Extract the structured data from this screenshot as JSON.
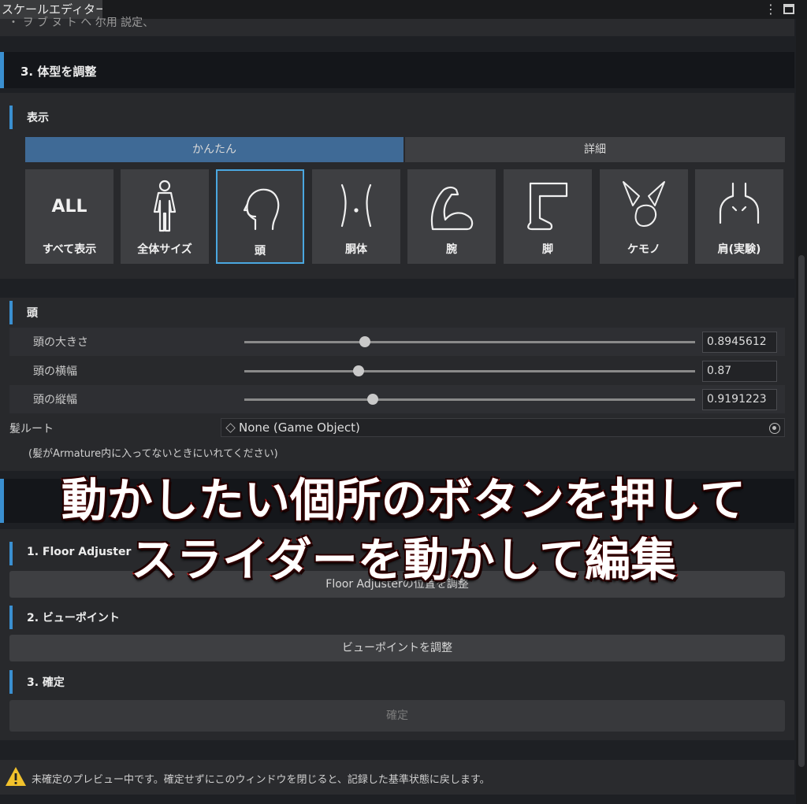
{
  "window": {
    "tab_title": "スケールエディター",
    "kebab": "⋮"
  },
  "top_cut_text": "・ ヲ ブ ヌ ト ヘ 尔用 説定、",
  "section3": {
    "title": "3. 体型を調整",
    "display_label": "表示",
    "tabs": [
      {
        "label": "かんたん",
        "active": true
      },
      {
        "label": "詳細",
        "active": false
      }
    ],
    "parts": [
      {
        "label": "すべて表示",
        "icon": "all-text-icon",
        "icon_text": "ALL"
      },
      {
        "label": "全体サイズ",
        "icon": "person-icon"
      },
      {
        "label": "頭",
        "icon": "head-icon",
        "selected": true
      },
      {
        "label": "胴体",
        "icon": "torso-icon"
      },
      {
        "label": "腕",
        "icon": "arm-icon"
      },
      {
        "label": "脚",
        "icon": "leg-icon"
      },
      {
        "label": "ケモノ",
        "icon": "kemono-ears-icon"
      },
      {
        "label": "肩(実験)",
        "icon": "shoulder-icon"
      }
    ]
  },
  "head": {
    "title": "頭",
    "sliders": [
      {
        "label": "頭の大きさ",
        "value": "0.8945612",
        "position": 0.28
      },
      {
        "label": "頭の横幅",
        "value": "0.87",
        "position": 0.255
      },
      {
        "label": "頭の縦幅",
        "value": "0.9191223",
        "position": 0.29
      }
    ],
    "hair_root": {
      "label": "髪ルート",
      "value": "None (Game Object)",
      "hint": "(髪がArmature内に入ってないときにいれてください)"
    }
  },
  "section4": {
    "title": "4. ...",
    "floor": {
      "title": "1. Floor Adjuster",
      "button": "Floor Adjusterの位置を調整"
    },
    "viewpoint": {
      "title": "2. ビューポイント",
      "button": "ビューポイントを調整"
    },
    "confirm": {
      "title": "3. 確定",
      "button": "確定"
    }
  },
  "footer_warning": "未確定のプレビュー中です。確定せずにこのウィンドウを閉じると、記録した基準状態に戻します。",
  "overlay_caption": {
    "line1": "動かしたい個所のボタンを押して",
    "line2": "スライダーを動かして編集"
  },
  "colors": {
    "accent": "#3a8fd0",
    "active_tab": "#3f6a96",
    "caption_outline": "#c01818"
  }
}
